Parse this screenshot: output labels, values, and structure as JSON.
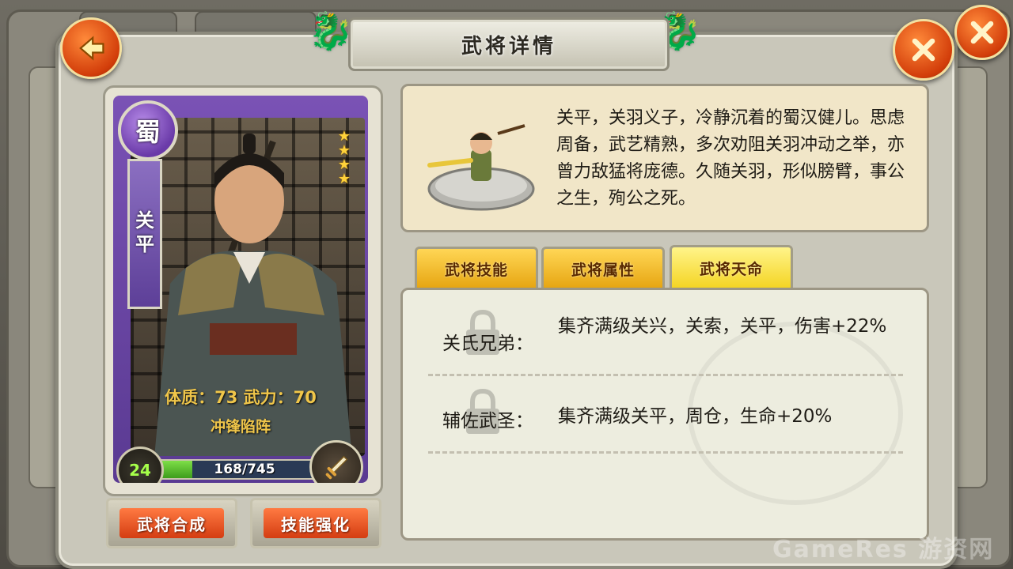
{
  "title": "武将详情",
  "hero": {
    "faction": "蜀",
    "name_chars": [
      "关",
      "平"
    ],
    "stars": 4,
    "stat_line": "体质：73   武力：70",
    "skill": "冲锋陷阵",
    "level": "24",
    "xp_text": "168/745",
    "xp_fraction": 0.225
  },
  "description": "关平，关羽义子，冷静沉着的蜀汉健儿。思虑周备，武艺精熟，多次劝阻关羽冲动之举，亦曾力敌猛将庞德。久随关羽，形似膀臂，事公之生，殉公之死。",
  "tabs": [
    "武将技能",
    "武将属性",
    "武将天命"
  ],
  "active_tab": 2,
  "fates": [
    {
      "name": "关氏兄弟：",
      "desc": "集齐满级关兴，关索，关平，伤害+22%"
    },
    {
      "name": "辅佐武圣：",
      "desc": "集齐满级关平，周仓，生命+20%"
    }
  ],
  "buttons": {
    "merge": "武将合成",
    "enhance": "技能强化"
  },
  "watermark": "GameRes 游资网",
  "colors": {
    "accent": "#d23d0a",
    "tab_gold": "#f4d422",
    "card_purple": "#6a3aa8",
    "xp_green": "#5bbd2e"
  }
}
